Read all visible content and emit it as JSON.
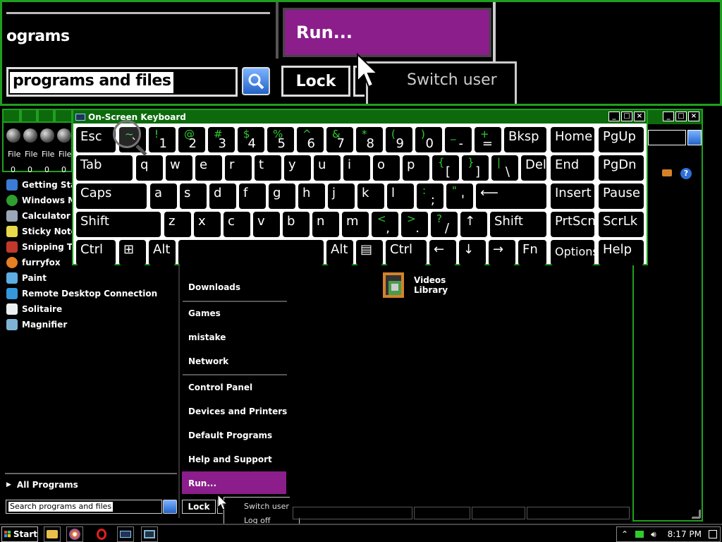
{
  "magnifier": {
    "programs_fragment": "ograms",
    "run_label": "Run...",
    "search_value": "programs and files",
    "lock_label": "Lock",
    "switch_user": "Switch user"
  },
  "background_windows": {
    "file_label": "File",
    "file_count": "0"
  },
  "start_menu": {
    "left_items": [
      {
        "label": "Getting Start",
        "icon": "getting-started-icon",
        "color": "#3a7bd5"
      },
      {
        "label": "Windows Me",
        "icon": "windows-media-icon",
        "color": "#2e9e2e"
      },
      {
        "label": "Calculator",
        "icon": "calculator-icon",
        "color": "#9aa7b8"
      },
      {
        "label": "Sticky Note",
        "icon": "sticky-notes-icon",
        "color": "#e8d84a"
      },
      {
        "label": "Snipping To",
        "icon": "snipping-tool-icon",
        "color": "#c0392b"
      },
      {
        "label": "furryfox",
        "icon": "firefox-icon",
        "color": "#e67e22"
      },
      {
        "label": "Paint",
        "icon": "paint-icon",
        "color": "#5dade2"
      },
      {
        "label": "Remote Desktop Connection",
        "icon": "remote-desktop-icon",
        "color": "#3498db"
      },
      {
        "label": "Solitaire",
        "icon": "solitaire-icon",
        "color": "#ecf0f1"
      },
      {
        "label": "Magnifier",
        "icon": "magnifier-icon",
        "color": "#7fb3d5"
      }
    ],
    "all_programs": "All Programs",
    "search_placeholder": "Search programs and files",
    "right_items": {
      "downloads": "Downloads",
      "games": "Games",
      "mistake": "mistake",
      "network": "Network",
      "control_panel": "Control Panel",
      "devices_printers": "Devices and Printers",
      "default_programs": "Default Programs",
      "help_support": "Help and Support",
      "run": "Run..."
    },
    "lock": "Lock",
    "switch_user": "Switch user",
    "log_off": "Log off"
  },
  "library": {
    "videos_line1": "Videos",
    "videos_line2": "Library"
  },
  "osk": {
    "title": "On-Screen Keyboard",
    "rows": [
      [
        {
          "main": "Esc"
        },
        {
          "sec": "~",
          "pri": "`"
        },
        {
          "sec": "!",
          "pri": "1"
        },
        {
          "sec": "@",
          "pri": "2"
        },
        {
          "sec": "#",
          "pri": "3"
        },
        {
          "sec": "$",
          "pri": "4"
        },
        {
          "sec": "%",
          "pri": "5"
        },
        {
          "sec": "^",
          "pri": "6"
        },
        {
          "sec": "&",
          "pri": "7"
        },
        {
          "sec": "*",
          "pri": "8"
        },
        {
          "sec": "(",
          "pri": "9"
        },
        {
          "sec": ")",
          "pri": "0"
        },
        {
          "sec": "_",
          "pri": "-"
        },
        {
          "sec": "+",
          "pri": "="
        },
        {
          "main": "Bksp"
        },
        {
          "main": "Home"
        },
        {
          "main": "PgUp"
        }
      ],
      [
        {
          "main": "Tab"
        },
        {
          "main": "q"
        },
        {
          "main": "w"
        },
        {
          "main": "e"
        },
        {
          "main": "r"
        },
        {
          "main": "t"
        },
        {
          "main": "y"
        },
        {
          "main": "u"
        },
        {
          "main": "i"
        },
        {
          "main": "o"
        },
        {
          "main": "p"
        },
        {
          "sec": "{",
          "pri": "["
        },
        {
          "sec": "}",
          "pri": "]"
        },
        {
          "sec": "|",
          "pri": "\\"
        },
        {
          "main": "Del"
        },
        {
          "main": "End"
        },
        {
          "main": "PgDn"
        }
      ],
      [
        {
          "main": "Caps"
        },
        {
          "main": "a"
        },
        {
          "main": "s"
        },
        {
          "main": "d"
        },
        {
          "main": "f"
        },
        {
          "main": "g"
        },
        {
          "main": "h"
        },
        {
          "main": "j"
        },
        {
          "main": "k"
        },
        {
          "main": "l"
        },
        {
          "sec": ":",
          "pri": ";"
        },
        {
          "sec": "\"",
          "pri": "'"
        },
        {
          "main": "⟵"
        },
        {
          "main": "Insert"
        },
        {
          "main": "Pause"
        }
      ],
      [
        {
          "main": "Shift"
        },
        {
          "main": "z"
        },
        {
          "main": "x"
        },
        {
          "main": "c"
        },
        {
          "main": "v"
        },
        {
          "main": "b"
        },
        {
          "main": "n"
        },
        {
          "main": "m"
        },
        {
          "sec": "<",
          "pri": ","
        },
        {
          "sec": ">",
          "pri": "."
        },
        {
          "sec": "?",
          "pri": "/"
        },
        {
          "main": "↑"
        },
        {
          "main": "Shift"
        },
        {
          "main": "PrtScn"
        },
        {
          "main": "ScrLk"
        }
      ],
      [
        {
          "main": "Ctrl"
        },
        {
          "main": "⊞"
        },
        {
          "main": "Alt"
        },
        {
          "main": ""
        },
        {
          "main": "Alt"
        },
        {
          "main": "▤"
        },
        {
          "main": "Ctrl"
        },
        {
          "main": "←"
        },
        {
          "main": "↓"
        },
        {
          "main": "→"
        },
        {
          "main": "Fn"
        },
        {
          "main": "Options"
        },
        {
          "main": "Help"
        }
      ]
    ]
  },
  "taskbar": {
    "start": "Start",
    "clock": "8:17 PM"
  }
}
